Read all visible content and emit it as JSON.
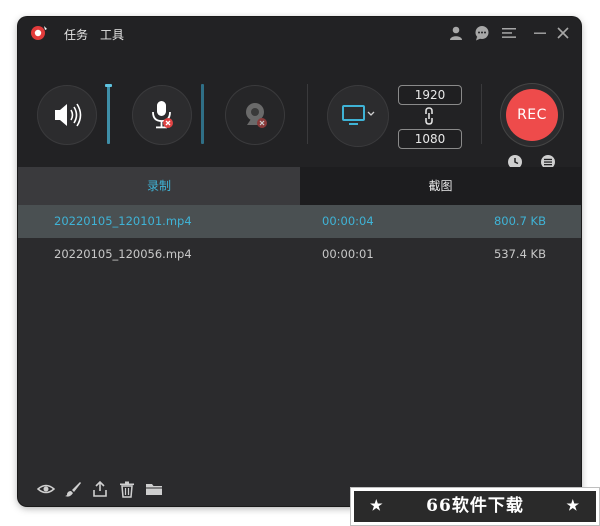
{
  "titlebar": {
    "menu": [
      "任务",
      "工具"
    ],
    "icons": [
      "user-icon",
      "chat-icon",
      "menu-icon",
      "minimize-icon",
      "close-icon"
    ]
  },
  "toolbar": {
    "resolution": {
      "width": "1920",
      "height": "1080"
    },
    "rec_label": "REC",
    "icons": [
      "speaker-icon",
      "microphone-muted-icon",
      "webcam-off-icon",
      "monitor-icon",
      "link-icon",
      "schedule-icon",
      "list-icon"
    ]
  },
  "tabs": [
    {
      "label": "录制",
      "active": true
    },
    {
      "label": "截图",
      "active": false
    }
  ],
  "files": [
    {
      "name": "20220105_120101.mp4",
      "duration": "00:00:04",
      "size": "800.7 KB",
      "selected": true
    },
    {
      "name": "20220105_120056.mp4",
      "duration": "00:00:01",
      "size": "537.4 KB",
      "selected": false
    }
  ],
  "bottom_icons": [
    "eye-icon",
    "brush-icon",
    "share-icon",
    "trash-icon",
    "folder-icon"
  ],
  "watermark": {
    "text": "66软件下载"
  },
  "colors": {
    "accent": "#3fb3d6",
    "rec": "#ee4b4b",
    "background": "#2b2b2d",
    "toolbar": "#222224"
  }
}
